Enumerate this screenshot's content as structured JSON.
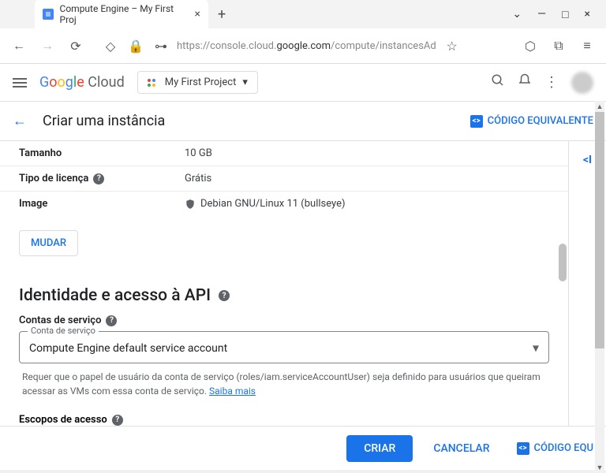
{
  "browser": {
    "tab_title": "Compute Engine – My First Proj",
    "url_prefix": "https://console.cloud.",
    "url_domain": "google.com",
    "url_suffix": "/compute/instancesAd"
  },
  "header": {
    "logo_cloud": " Cloud",
    "project_name": "My First Project"
  },
  "page": {
    "title": "Criar uma instância",
    "code_equiv_label": "CÓDIGO EQUIVALENTE"
  },
  "disk": {
    "size_label": "Tamanho",
    "size_value": "10 GB",
    "license_label": "Tipo de licença",
    "license_value": "Grátis",
    "image_label": "Image",
    "image_value": "Debian GNU/Linux 11 (bullseye)",
    "change_btn": "MUDAR"
  },
  "identity": {
    "section_title": "Identidade e acesso à API",
    "service_accounts_label": "Contas de serviço",
    "select_float_label": "Conta de serviço",
    "select_value": "Compute Engine default service account",
    "helper_text_1": "Requer que o papel de usuário da conta de serviço (roles/iam.serviceAccountUser) seja definido para usuários que queiram acessar as VMs com essa conta de serviço. ",
    "helper_link": "Saiba mais",
    "scopes_label": "Escopos de acesso"
  },
  "footer": {
    "create": "CRIAR",
    "cancel": "CANCELAR",
    "code_equiv": "CÓDIGO EQU"
  }
}
